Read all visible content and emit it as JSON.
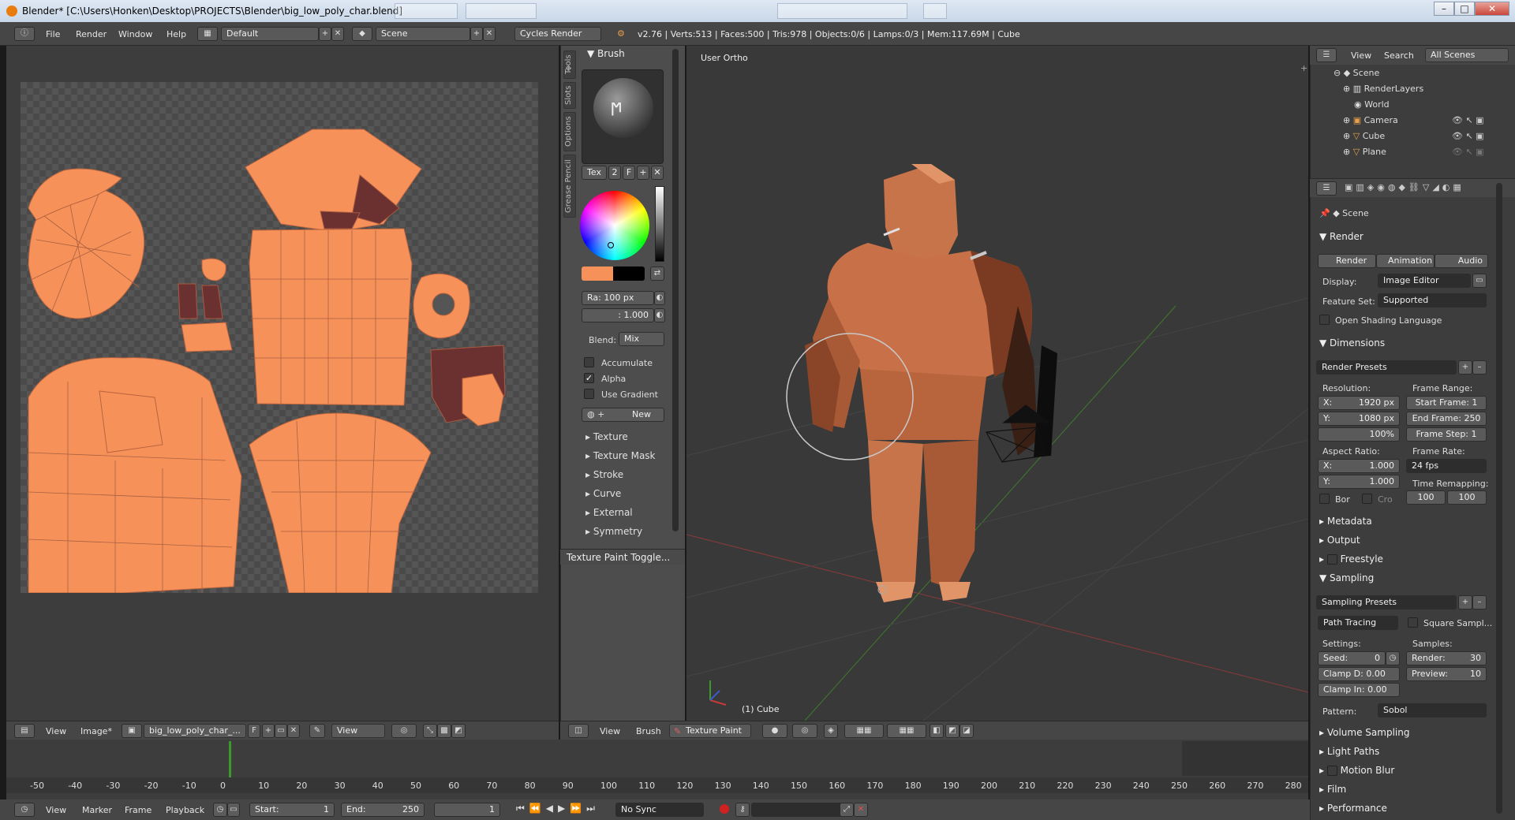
{
  "window": {
    "title": "Blender* [C:\\Users\\Honken\\Desktop\\PROJECTS\\Blender\\big_low_poly_char.blend]",
    "min": "–",
    "max": "□",
    "close": "✕"
  },
  "infobar": {
    "menus": [
      "File",
      "Render",
      "Window",
      "Help"
    ],
    "layout": "Default",
    "scene": "Scene",
    "engine": "Cycles Render",
    "stats": "v2.76 | Verts:513 | Faces:500 | Tris:978 | Objects:0/6 | Lamps:0/3 | Mem:117.69M | Cube"
  },
  "uv_editor": {
    "footer": {
      "view": "View",
      "image": "Image*",
      "image_name": "big_low_poly_char_...",
      "fake": "F",
      "view2": "View"
    }
  },
  "tools_panel": {
    "tabs": [
      "Tools",
      "Slots",
      "Options",
      "Grease Pencil"
    ],
    "brush_header": "Brush",
    "tex_btn": "Tex",
    "tex_num": "2",
    "tex_f": "F",
    "radius": "Ra: 100 px",
    "strength": ": 1.000",
    "blend_label": "Blend:",
    "blend_value": "Mix",
    "accumulate": "Accumulate",
    "alpha": "Alpha",
    "use_gradient": "Use Gradient",
    "new_btn": "New",
    "sections": [
      "Texture",
      "Texture Mask",
      "Stroke",
      "Curve",
      "External",
      "Symmetry"
    ],
    "toggle_header": "Texture Paint Toggle..."
  },
  "viewport": {
    "view_label": "User Ortho",
    "object_label": "(1) Cube",
    "footer": {
      "view": "View",
      "brush": "Brush",
      "mode": "Texture Paint"
    }
  },
  "outliner": {
    "header": {
      "view": "View",
      "search": "Search",
      "filter": "All Scenes"
    },
    "items": [
      "Scene",
      "RenderLayers",
      "World",
      "Camera",
      "Cube",
      "Plane"
    ]
  },
  "properties": {
    "context": "Scene",
    "render_header": "Render",
    "render_buttons": [
      "Render",
      "Animation",
      "Audio"
    ],
    "display_label": "Display:",
    "display_value": "Image Editor",
    "feature_label": "Feature Set:",
    "feature_value": "Supported",
    "osl": "Open Shading Language",
    "dimensions_header": "Dimensions",
    "render_presets": "Render Presets",
    "resolution_label": "Resolution:",
    "res_x": "X:",
    "res_x_val": "1920 px",
    "res_y": "Y:",
    "res_y_val": "1080 px",
    "res_pct": "100%",
    "frame_range_label": "Frame Range:",
    "start_frame": "Start Frame: 1",
    "end_frame": "End Frame: 250",
    "frame_step": "Frame Step: 1",
    "aspect_label": "Aspect Ratio:",
    "asp_x": "X:",
    "asp_x_val": "1.000",
    "asp_y": "Y:",
    "asp_y_val": "1.000",
    "frame_rate_label": "Frame Rate:",
    "frame_rate": "24 fps",
    "time_remap_label": "Time Remapping:",
    "remap_old": "100",
    "remap_new": "100",
    "bor": "Bor",
    "cro": "Cro",
    "collapsed1": [
      "Metadata",
      "Output",
      "Freestyle"
    ],
    "sampling_header": "Sampling",
    "sampling_presets": "Sampling Presets",
    "path_tracing": "Path Tracing",
    "square_samples": "Square Sampl...",
    "settings_label": "Settings:",
    "samples_label": "Samples:",
    "seed_label": "Seed:",
    "seed_val": "0",
    "render_samples_label": "Render:",
    "render_samples": "30",
    "clamp_direct": "Clamp D: 0.00",
    "preview_label": "Preview:",
    "preview_samples": "10",
    "clamp_indirect": "Clamp In: 0.00",
    "pattern_label": "Pattern:",
    "pattern_value": "Sobol",
    "collapsed2": [
      "Volume Sampling",
      "Light Paths",
      "Motion Blur",
      "Film",
      "Performance"
    ]
  },
  "timeline": {
    "ticks": [
      "-50",
      "-40",
      "-30",
      "-20",
      "-10",
      "0",
      "10",
      "20",
      "30",
      "40",
      "50",
      "60",
      "70",
      "80",
      "90",
      "100",
      "110",
      "120",
      "130",
      "140",
      "150",
      "160",
      "170",
      "180",
      "190",
      "200",
      "210",
      "220",
      "230",
      "240",
      "250",
      "260",
      "270",
      "280"
    ],
    "footer": {
      "view": "View",
      "marker": "Marker",
      "frame": "Frame",
      "playback": "Playback",
      "start": "Start:",
      "start_val": "1",
      "end": "End:",
      "end_val": "250",
      "current": "1",
      "sync": "No Sync"
    }
  }
}
